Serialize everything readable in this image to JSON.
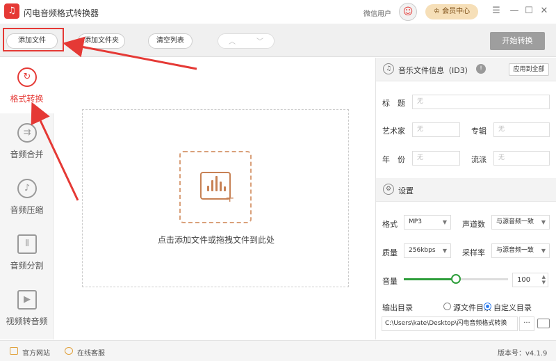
{
  "app": {
    "title": "闪电音频格式转换器",
    "logo_glyph": "♫"
  },
  "header": {
    "wechat_user": "微信用户",
    "vip_label": "会员中心",
    "vip_icon": "crown-icon"
  },
  "window": {
    "settings_icon": "☰",
    "minimize": "—",
    "maximize": "☐",
    "close": "✕"
  },
  "toolbar": {
    "add_file": "添加文件",
    "add_folder": "添加文件夹",
    "clear_list": "清空列表",
    "up": "︿",
    "down": "﹀",
    "start": "开始转换"
  },
  "sidebar": {
    "items": [
      {
        "label": "格式转换",
        "icon": "↻",
        "active": true
      },
      {
        "label": "音频合并",
        "icon": "⇉",
        "active": false
      },
      {
        "label": "音频压缩",
        "icon": "♪",
        "active": false
      },
      {
        "label": "音频分割",
        "icon": "⫴",
        "active": false
      },
      {
        "label": "视频转音频",
        "icon": "▶",
        "active": false
      }
    ]
  },
  "dropzone": {
    "text": "点击添加文件或拖拽文件到此处"
  },
  "id3": {
    "title": "音乐文件信息（ID3）",
    "apply_all": "应用到全部",
    "title_label": "标　题",
    "artist_label": "艺术家",
    "album_label": "专辑",
    "year_label": "年　份",
    "genre_label": "流派",
    "placeholder": "无"
  },
  "settings": {
    "title": "设置",
    "format_label": "格式",
    "format_value": "MP3",
    "channels_label": "声道数",
    "channels_value": "与源音频一致",
    "quality_label": "质量",
    "quality_value": "256kbps",
    "samplerate_label": "采样率",
    "samplerate_value": "与源音频一致",
    "volume_label": "音量",
    "volume_value": "100",
    "volume_fraction": 0.5,
    "output_label": "输出目录",
    "option_source": "源文件目录",
    "option_custom": "自定义目录",
    "output_path": "C:\\Users\\kate\\Desktop\\闪电音频格式转换",
    "browse": "···"
  },
  "status": {
    "website": "官方网站",
    "support": "在线客服",
    "version": "版本号：v4.1.9"
  },
  "colors": {
    "accent": "#e53935",
    "slider": "#2e9e3b",
    "start_btn": "#9e9e9e",
    "vip_bg": "#f6dfb8"
  }
}
